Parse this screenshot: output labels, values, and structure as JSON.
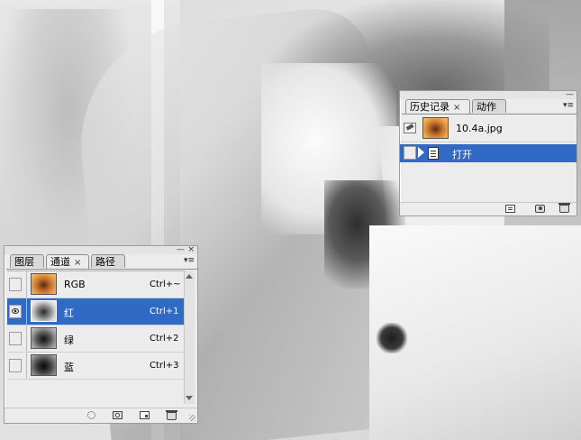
{
  "history_panel": {
    "tabs": [
      {
        "label": "历史记录",
        "active": true,
        "closable": true
      },
      {
        "label": "动作",
        "active": false,
        "closable": false
      }
    ],
    "snapshot_name": "10.4a.jpg",
    "states": [
      {
        "label": "打开",
        "selected": true,
        "icon": "document-icon"
      }
    ],
    "bottom_icons": [
      "new-document-from-state-icon",
      "new-snapshot-icon",
      "delete-icon"
    ]
  },
  "channels_panel": {
    "tabs": [
      {
        "label": "图层",
        "active": false,
        "closable": false
      },
      {
        "label": "通道",
        "active": true,
        "closable": true
      },
      {
        "label": "路径",
        "active": false,
        "closable": false
      }
    ],
    "channels": [
      {
        "name": "RGB",
        "shortcut": "Ctrl+~",
        "visible": false,
        "selected": false,
        "thumb": "color"
      },
      {
        "name": "红",
        "shortcut": "Ctrl+1",
        "visible": true,
        "selected": true,
        "thumb": "gray-light"
      },
      {
        "name": "绿",
        "shortcut": "Ctrl+2",
        "visible": false,
        "selected": false,
        "thumb": "gray-mid"
      },
      {
        "name": "蓝",
        "shortcut": "Ctrl+3",
        "visible": false,
        "selected": false,
        "thumb": "gray-dark"
      }
    ],
    "bottom_icons": [
      "load-selection-icon",
      "save-selection-icon",
      "new-channel-icon",
      "delete-channel-icon"
    ]
  },
  "panel_controls": {
    "minimize": "—",
    "close": "×",
    "menu": "▾≡",
    "tab_close": "×"
  },
  "colors": {
    "selection": "#316ac5",
    "panel_bg": "#ececec"
  }
}
